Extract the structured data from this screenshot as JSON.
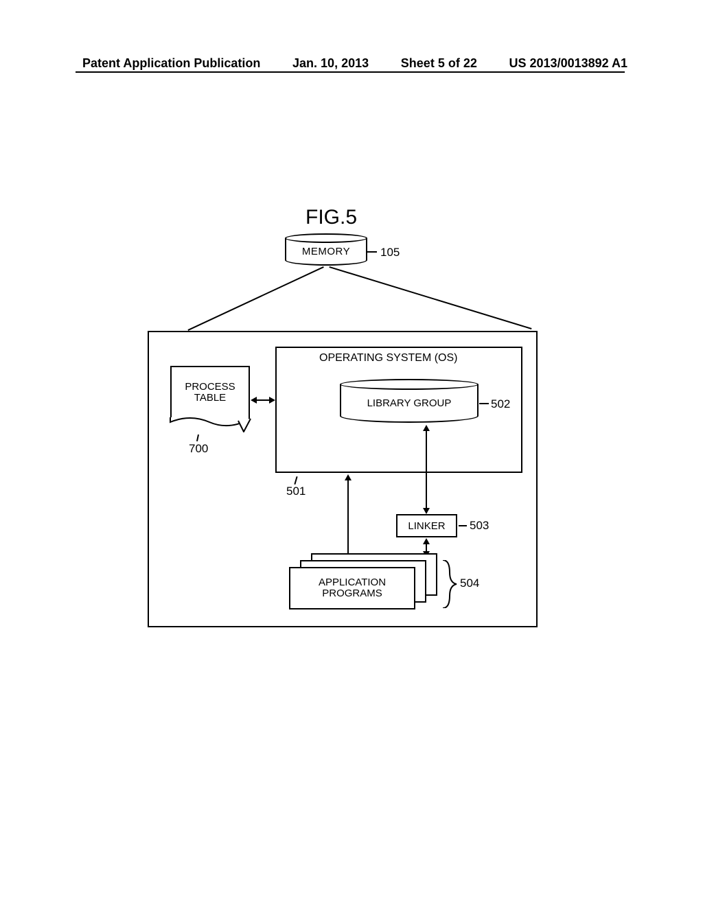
{
  "header": {
    "pub_type": "Patent Application Publication",
    "date": "Jan. 10, 2013",
    "sheet": "Sheet 5 of 22",
    "pub_number": "US 2013/0013892 A1"
  },
  "figure": {
    "title": "FIG.5",
    "memory": {
      "label": "MEMORY",
      "ref": "105"
    },
    "os": {
      "title": "OPERATING SYSTEM (OS)",
      "ref": "501"
    },
    "library": {
      "label": "LIBRARY GROUP",
      "ref": "502"
    },
    "process_table": {
      "label": "PROCESS\nTABLE",
      "ref": "700"
    },
    "linker": {
      "label": "LINKER",
      "ref": "503"
    },
    "apps": {
      "label": "APPLICATION\nPROGRAMS",
      "ref": "504"
    }
  }
}
